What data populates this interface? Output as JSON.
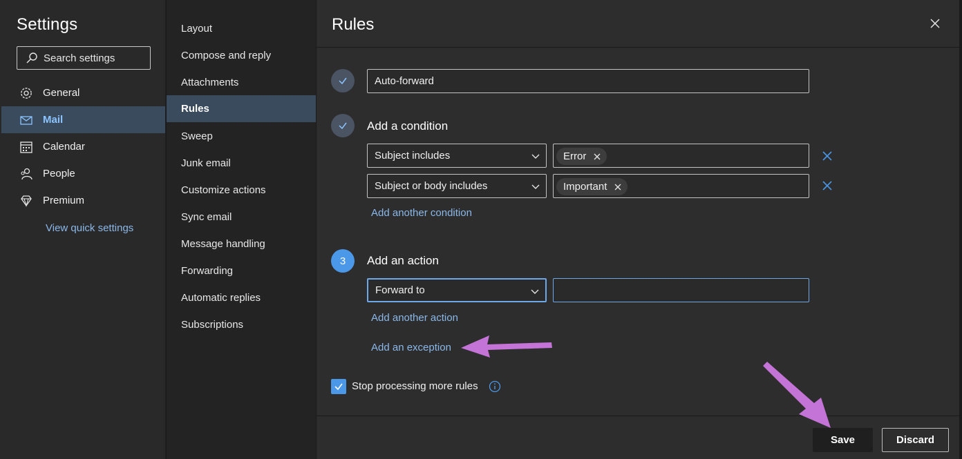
{
  "settings": {
    "title": "Settings",
    "search_placeholder": "Search settings",
    "nav": [
      {
        "label": "General",
        "icon": "gear-icon"
      },
      {
        "label": "Mail",
        "icon": "mail-icon"
      },
      {
        "label": "Calendar",
        "icon": "calendar-icon"
      },
      {
        "label": "People",
        "icon": "people-icon"
      },
      {
        "label": "Premium",
        "icon": "diamond-icon"
      }
    ],
    "quick_link": "View quick settings"
  },
  "subnav": {
    "items": [
      "Layout",
      "Compose and reply",
      "Attachments",
      "Rules",
      "Sweep",
      "Junk email",
      "Customize actions",
      "Sync email",
      "Message handling",
      "Forwarding",
      "Automatic replies",
      "Subscriptions"
    ],
    "active": "Rules"
  },
  "rules": {
    "title": "Rules",
    "rule_name": "Auto-forward",
    "condition_heading": "Add a condition",
    "conditions": [
      {
        "field": "Subject includes",
        "chip": "Error"
      },
      {
        "field": "Subject or body includes",
        "chip": "Important"
      }
    ],
    "add_condition_link": "Add another condition",
    "action_step_number": "3",
    "action_heading": "Add an action",
    "action_field": "Forward to",
    "action_value": "",
    "add_action_link": "Add another action",
    "add_exception_link": "Add an exception",
    "stop_processing_label": "Stop processing more rules",
    "stop_processing_checked": true,
    "save_label": "Save",
    "discard_label": "Discard"
  },
  "colors": {
    "accent": "#4b97e8",
    "link": "#8ab8ea",
    "annotation_arrow": "#c473d6"
  }
}
